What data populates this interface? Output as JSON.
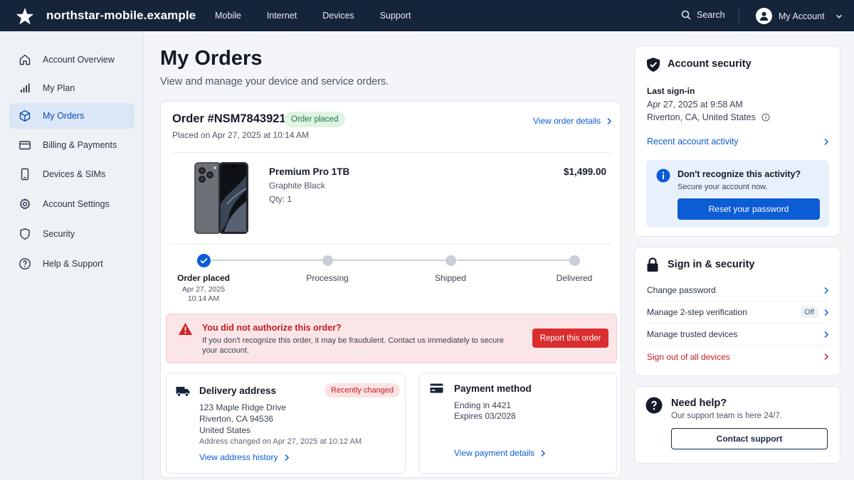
{
  "header": {
    "brand": "northstar-mobile.example",
    "nav": [
      "Mobile",
      "Internet",
      "Devices",
      "Support"
    ],
    "search_label": "Search",
    "account_label": "My Account"
  },
  "sidebar": {
    "items": [
      {
        "label": "Account Overview",
        "icon": "home-icon"
      },
      {
        "label": "My Plan",
        "icon": "signal-bars-icon"
      },
      {
        "label": "My Orders",
        "icon": "box-icon",
        "active": true
      },
      {
        "label": "Billing & Payments",
        "icon": "credit-card-icon"
      },
      {
        "label": "Devices & SIMs",
        "icon": "phone-icon"
      },
      {
        "label": "Account Settings",
        "icon": "gear-icon"
      },
      {
        "label": "Security",
        "icon": "shield-icon"
      },
      {
        "label": "Help & Support",
        "icon": "help-circle-icon"
      }
    ]
  },
  "main": {
    "title": "My Orders",
    "subtitle": "View and manage your device and service orders."
  },
  "order": {
    "number": "Order #NSM7843921",
    "status_badge": "Order placed",
    "placed_on": "Placed on Apr 27, 2025 at 10:14 AM",
    "view_details": "View order details",
    "product": {
      "name": "Premium Pro 1TB",
      "color": "Graphite Black",
      "qty": "Qty: 1",
      "price": "$1,499.00"
    },
    "steps": [
      {
        "label": "Order placed",
        "date": "Apr 27, 2025",
        "time": "10:14 AM",
        "done": true
      },
      {
        "label": "Processing",
        "done": false
      },
      {
        "label": "Shipped",
        "done": false
      },
      {
        "label": "Delivered",
        "done": false
      }
    ],
    "alert": {
      "title": "You did not authorize this order?",
      "body": "If you don't recognize this order, it may be fraudulent. Contact us immediately to secure your account.",
      "button": "Report this order"
    },
    "delivery": {
      "title": "Delivery address",
      "badge": "Recently changed",
      "line1": "123 Maple Ridge Drive",
      "line2": "Riverton, CA 94536",
      "line3": "United States",
      "note": "Address changed on Apr 27, 2025 at 10:12 AM",
      "link": "View address history"
    },
    "payment": {
      "title": "Payment method",
      "ending": "Ending in 4421",
      "expires": "Expires 03/2028",
      "link": "View payment details"
    }
  },
  "security_card": {
    "title": "Account security",
    "last_signin_label": "Last sign-in",
    "last_signin_time": "Apr 27, 2025 at 9:58 AM",
    "last_signin_location": "Riverton, CA, United States",
    "recent_activity": "Recent account activity",
    "info_title": "Don't recognize this activity?",
    "info_sub": "Secure your account now.",
    "reset_button": "Reset your password"
  },
  "signin_card": {
    "title": "Sign in & security",
    "rows": [
      {
        "label": "Change password"
      },
      {
        "label": "Manage 2-step verification",
        "badge": "Off"
      },
      {
        "label": "Manage trusted devices"
      },
      {
        "label": "Sign out of all devices",
        "danger": true
      }
    ]
  },
  "help_card": {
    "title": "Need help?",
    "sub": "Our support team is here 24/7.",
    "button": "Contact support"
  },
  "colors": {
    "topbar": "#16243a",
    "accent": "#0b5cd5",
    "danger": "#d92d2f",
    "success": "#1c7a3e"
  }
}
